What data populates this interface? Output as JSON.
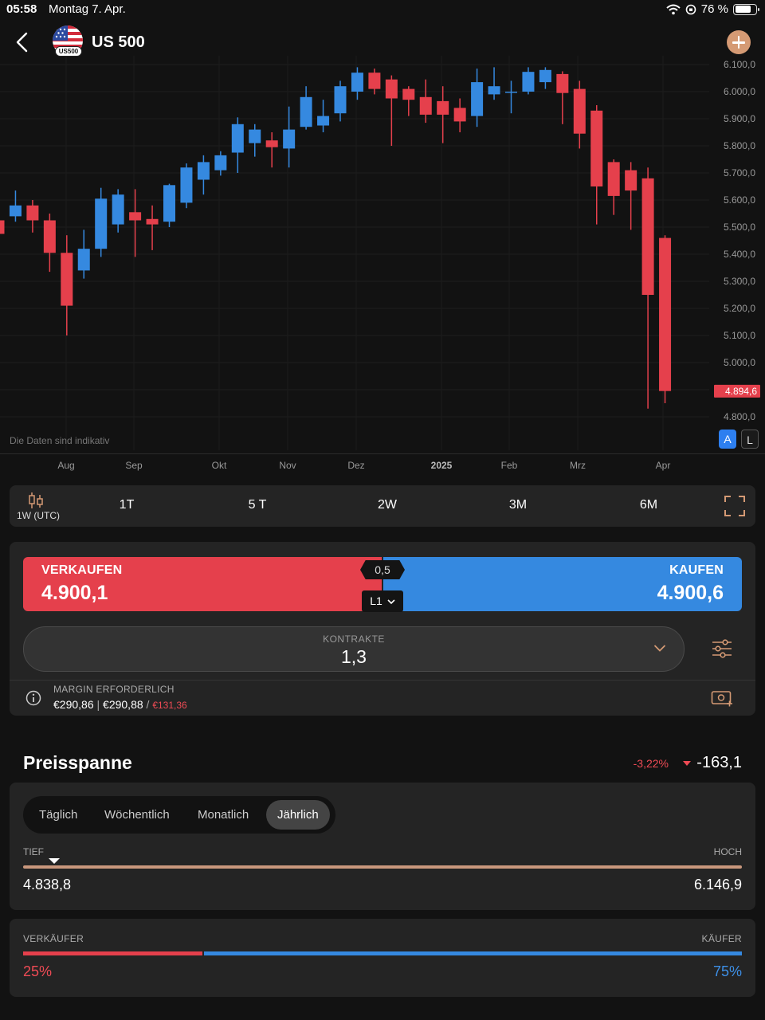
{
  "status_bar": {
    "time": "05:58",
    "date": "Montag 7. Apr.",
    "battery": "76 %",
    "battery_level": 0.76
  },
  "header": {
    "title": "US 500",
    "flag_badge": "US500"
  },
  "chart": {
    "disclaimer": "Die Daten sind indikativ",
    "current_price_label": "4.894,6",
    "scale_auto": "A",
    "scale_log": "L"
  },
  "chart_data": {
    "type": "candlestick",
    "y_ticks": [
      "6.100,0",
      "6.000,0",
      "5.900,0",
      "5.800,0",
      "5.700,0",
      "5.600,0",
      "5.500,0",
      "5.400,0",
      "5.300,0",
      "5.200,0",
      "5.100,0",
      "5.000,0",
      "4.800,0"
    ],
    "x_ticks": [
      "Aug",
      "Sep",
      "Okt",
      "Nov",
      "Dez",
      "2025",
      "Feb",
      "Mrz",
      "Apr"
    ],
    "ylim": [
      4760,
      6120
    ],
    "candles": [
      [
        5525,
        5475,
        5595,
        5465
      ],
      [
        5540,
        5580,
        5635,
        5520
      ],
      [
        5580,
        5525,
        5600,
        5480
      ],
      [
        5525,
        5405,
        5550,
        5335
      ],
      [
        5405,
        5210,
        5470,
        5100
      ],
      [
        5340,
        5420,
        5490,
        5310
      ],
      [
        5420,
        5605,
        5645,
        5390
      ],
      [
        5510,
        5620,
        5640,
        5480
      ],
      [
        5555,
        5525,
        5640,
        5390
      ],
      [
        5530,
        5510,
        5580,
        5415
      ],
      [
        5520,
        5655,
        5660,
        5500
      ],
      [
        5590,
        5720,
        5735,
        5570
      ],
      [
        5675,
        5740,
        5765,
        5620
      ],
      [
        5710,
        5765,
        5780,
        5690
      ],
      [
        5775,
        5880,
        5905,
        5700
      ],
      [
        5810,
        5860,
        5880,
        5760
      ],
      [
        5820,
        5795,
        5850,
        5720
      ],
      [
        5790,
        5860,
        5945,
        5720
      ],
      [
        5870,
        5980,
        6020,
        5860
      ],
      [
        5875,
        5910,
        5970,
        5850
      ],
      [
        5920,
        6020,
        6040,
        5890
      ],
      [
        6000,
        6070,
        6090,
        5970
      ],
      [
        6070,
        6010,
        6085,
        5990
      ],
      [
        6045,
        5975,
        6060,
        5800
      ],
      [
        6010,
        5970,
        6020,
        5910
      ],
      [
        5980,
        5915,
        6045,
        5885
      ],
      [
        5965,
        5915,
        6020,
        5810
      ],
      [
        5940,
        5890,
        5975,
        5850
      ],
      [
        5910,
        6035,
        6085,
        5870
      ],
      [
        5990,
        6020,
        6090,
        5970
      ],
      [
        6000,
        6000,
        6040,
        5920
      ],
      [
        6000,
        6073,
        6090,
        5990
      ],
      [
        6035,
        6080,
        6090,
        6010
      ],
      [
        6065,
        5995,
        6075,
        5880
      ],
      [
        6010,
        5845,
        6040,
        5790
      ],
      [
        5930,
        5650,
        5950,
        5510
      ],
      [
        5740,
        5615,
        5750,
        5545
      ],
      [
        5710,
        5635,
        5740,
        5490
      ],
      [
        5680,
        5250,
        5720,
        4830
      ],
      [
        5460,
        4895,
        5470,
        4850
      ]
    ]
  },
  "timeframe": {
    "resolution": "1W (UTC)",
    "items": [
      "1T",
      "5 T",
      "2W",
      "3M",
      "6M"
    ]
  },
  "trade": {
    "sell_label": "VERKAUFEN",
    "sell_price": "4.900,1",
    "buy_label": "KAUFEN",
    "buy_price": "4.900,6",
    "spread": "0,5",
    "level": "L1",
    "contracts_label": "KONTRAKTE",
    "contracts_value": "1,3",
    "margin_label": "MARGIN ERFORDERLICH",
    "margin_sell": "€290,86",
    "margin_sep": "|",
    "margin_buy": "€290,88",
    "margin_slash": "/",
    "margin_free": "€131,36"
  },
  "price_range": {
    "title": "Preisspanne",
    "change_pct": "-3,22%",
    "change_value": "-163,1",
    "tabs": [
      "Täglich",
      "Wöchentlich",
      "Monatlich",
      "Jährlich"
    ],
    "active_tab": "Jährlich",
    "low_label": "TIEF",
    "high_label": "HOCH",
    "low_value": "4.838,8",
    "high_value": "6.146,9",
    "marker_position": 0.043
  },
  "sentiment": {
    "sell_label": "VERKÄUFER",
    "buy_label": "KÄUFER",
    "sell_pct": "25%",
    "buy_pct": "75%",
    "sell_share": 0.25
  },
  "colors": {
    "bull": "#3589e0",
    "bear": "#e5404c",
    "accent": "#d59a74",
    "background": "#121212"
  }
}
